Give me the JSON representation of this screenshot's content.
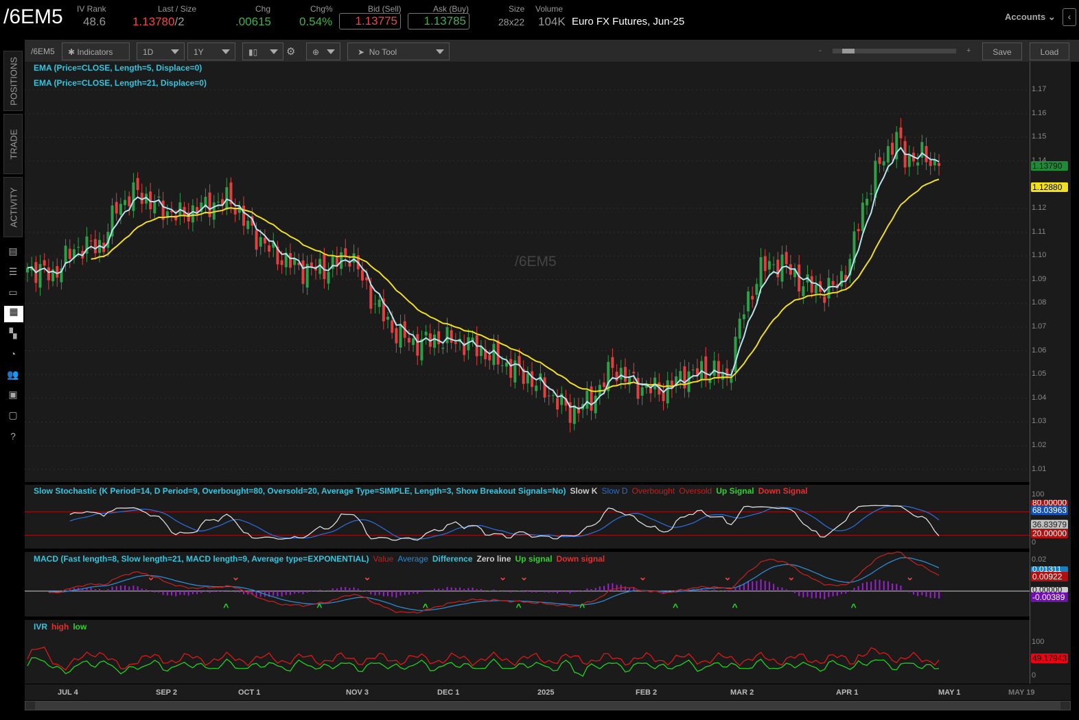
{
  "header": {
    "symbol": "/6EM5",
    "iv_rank_label": "IV Rank",
    "iv_rank": "48.6",
    "last_label": "Last / Size",
    "last": "1.13780",
    "last_size": "/2",
    "chg_label": "Chg",
    "chg": ".00615",
    "chgpct_label": "Chg%",
    "chgpct": "0.54%",
    "bid_label": "Bid (Sell)",
    "bid": "1.13775",
    "ask_label": "Ask (Buy)",
    "ask": "1.13785",
    "size_label": "Size",
    "size": "28x22",
    "volume_label": "Volume",
    "volume": "104K",
    "description": "Euro FX Futures, Jun-25",
    "accounts": "Accounts"
  },
  "toolbar": {
    "symbol": "/6EM5",
    "indicators": "Indicators",
    "aggregation": "1D",
    "range": "1Y",
    "tool": "No Tool",
    "zoom_minus": "-",
    "zoom_plus": "+",
    "save": "Save",
    "load": "Load"
  },
  "sidebar": {
    "tabs": [
      "POSITIONS",
      "TRADE",
      "ACTIVITY"
    ]
  },
  "chart": {
    "watermark": "/6EM5",
    "studies": [
      "EMA (Price=CLOSE, Length=5, Displace=0)",
      "EMA (Price=CLOSE, Length=21, Displace=0)"
    ],
    "price_ticks": [
      "1.17",
      "1.16",
      "1.15",
      "1.14",
      "1.12",
      "1.11",
      "1.10",
      "1.09",
      "1.08",
      "1.07",
      "1.06",
      "1.05",
      "1.04",
      "1.03",
      "1.02",
      "1.01"
    ],
    "last_label": "1.13790",
    "ema21_label": "1.12880"
  },
  "stoch": {
    "title": "Slow Stochastic (K Period=14, D Period=9, Overbought=80, Oversold=20, Average Type=SIMPLE, Length=3, Show Breakout Signals=No)",
    "legend": [
      "Slow K",
      "Slow D",
      "Overbought",
      "Oversold",
      "Up Signal",
      "Down Signal"
    ],
    "ticks": [
      "100",
      "0"
    ],
    "labels": [
      "80.00000",
      "68.03963",
      "36.83979",
      "20.00000"
    ]
  },
  "macd": {
    "title": "MACD (Fast length=8, Slow length=21, MACD length=9, Average type=EXPONENTIAL)",
    "legend": [
      "Value",
      "Average",
      "Difference",
      "Zero line",
      "Up signal",
      "Down signal"
    ],
    "ticks": [
      "0.02"
    ],
    "labels": [
      "0.01311",
      "0.00922",
      "0.00000",
      "-0.00389"
    ]
  },
  "ivr": {
    "title": "IVR",
    "legend": [
      "high",
      "low"
    ],
    "ticks": [
      "100",
      "0"
    ],
    "label": "49.17943"
  },
  "dates": [
    "JUL 4",
    "SEP 2",
    "OCT 1",
    "NOV 3",
    "DEC 1",
    "2025",
    "FEB 2",
    "MAR 2",
    "APR 1",
    "MAY 1",
    "MAY 19"
  ],
  "colors": {
    "up": "#2e9e48",
    "down": "#e04040",
    "ema5": "#b8e6f0",
    "ema21": "#f0e020"
  },
  "chart_data": {
    "type": "candlestick",
    "ylim": [
      1.005,
      1.175
    ],
    "anchors": [
      [
        0,
        1.095
      ],
      [
        6,
        1.092
      ],
      [
        11,
        1.103
      ],
      [
        18,
        1.105
      ],
      [
        21,
        1.121
      ],
      [
        26,
        1.127
      ],
      [
        31,
        1.12
      ],
      [
        36,
        1.117
      ],
      [
        42,
        1.121
      ],
      [
        48,
        1.124
      ],
      [
        52,
        1.112
      ],
      [
        58,
        1.101
      ],
      [
        65,
        1.094
      ],
      [
        71,
        1.095
      ],
      [
        76,
        1.101
      ],
      [
        81,
        1.083
      ],
      [
        86,
        1.069
      ],
      [
        91,
        1.063
      ],
      [
        97,
        1.065
      ],
      [
        104,
        1.063
      ],
      [
        110,
        1.057
      ],
      [
        117,
        1.05
      ],
      [
        123,
        1.042
      ],
      [
        128,
        1.034
      ],
      [
        133,
        1.039
      ],
      [
        138,
        1.053
      ],
      [
        144,
        1.045
      ],
      [
        150,
        1.043
      ],
      [
        155,
        1.05
      ],
      [
        162,
        1.052
      ],
      [
        165,
        1.047
      ],
      [
        168,
        1.072
      ],
      [
        173,
        1.095
      ],
      [
        178,
        1.097
      ],
      [
        183,
        1.088
      ],
      [
        188,
        1.085
      ],
      [
        191,
        1.088
      ],
      [
        194,
        1.098
      ],
      [
        197,
        1.121
      ],
      [
        201,
        1.139
      ],
      [
        205,
        1.15
      ],
      [
        207,
        1.141
      ],
      [
        211,
        1.142
      ],
      [
        215,
        1.1379
      ]
    ]
  }
}
